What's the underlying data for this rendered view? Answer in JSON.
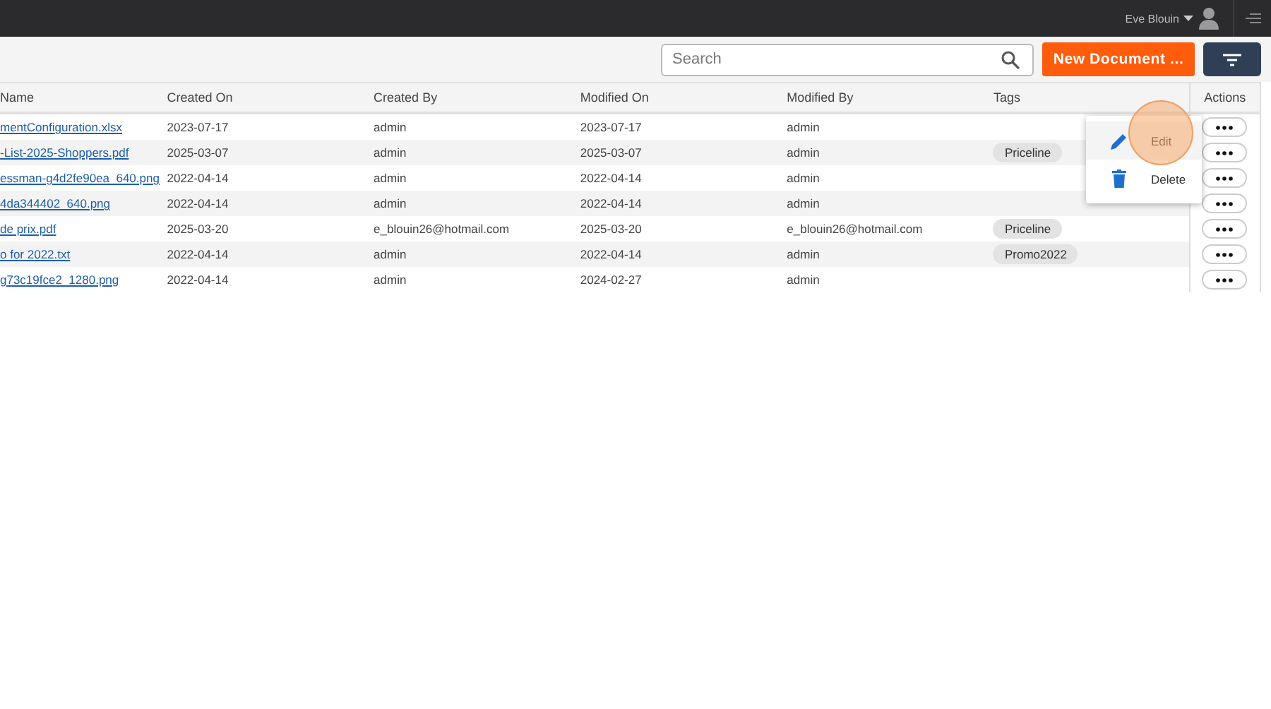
{
  "user_menu": {
    "name": "Eve Blouin"
  },
  "toolbar": {
    "search": {
      "placeholder": "Search"
    },
    "new_button": "New Document ..."
  },
  "table": {
    "columns": [
      "Name",
      "Created On",
      "Created By",
      "Modified On",
      "Modified By",
      "Tags",
      "Actions"
    ],
    "rows": [
      {
        "name": "mentConfiguration.xlsx",
        "created_on": "2023-07-17",
        "created_by": "admin",
        "modified_on": "2023-07-17",
        "modified_by": "admin",
        "tags": []
      },
      {
        "name": "-List-2025-Shoppers.pdf",
        "created_on": "2025-03-07",
        "created_by": "admin",
        "modified_on": "2025-03-07",
        "modified_by": "admin",
        "tags": [
          "Priceline"
        ]
      },
      {
        "name": "essman-g4d2fe90ea_640.png",
        "created_on": "2022-04-14",
        "created_by": "admin",
        "modified_on": "2022-04-14",
        "modified_by": "admin",
        "tags": []
      },
      {
        "name": "4da344402_640.png",
        "created_on": "2022-04-14",
        "created_by": "admin",
        "modified_on": "2022-04-14",
        "modified_by": "admin",
        "tags": []
      },
      {
        "name": "de prix.pdf",
        "created_on": "2025-03-20",
        "created_by": "e_blouin26@hotmail.com",
        "modified_on": "2025-03-20",
        "modified_by": "e_blouin26@hotmail.com",
        "tags": [
          "Priceline"
        ]
      },
      {
        "name": "o for 2022.txt",
        "created_on": "2022-04-14",
        "created_by": "admin",
        "modified_on": "2022-04-14",
        "modified_by": "admin",
        "tags": [
          "Promo2022"
        ]
      },
      {
        "name": "g73c19fce2_1280.png",
        "created_on": "2022-04-14",
        "created_by": "admin",
        "modified_on": "2024-02-27",
        "modified_by": "admin",
        "tags": []
      }
    ]
  },
  "context_menu": {
    "items": [
      {
        "kind": "edit",
        "label": "Edit",
        "highlighted": true
      },
      {
        "kind": "delete",
        "label": "Delete",
        "highlighted": false
      }
    ]
  }
}
